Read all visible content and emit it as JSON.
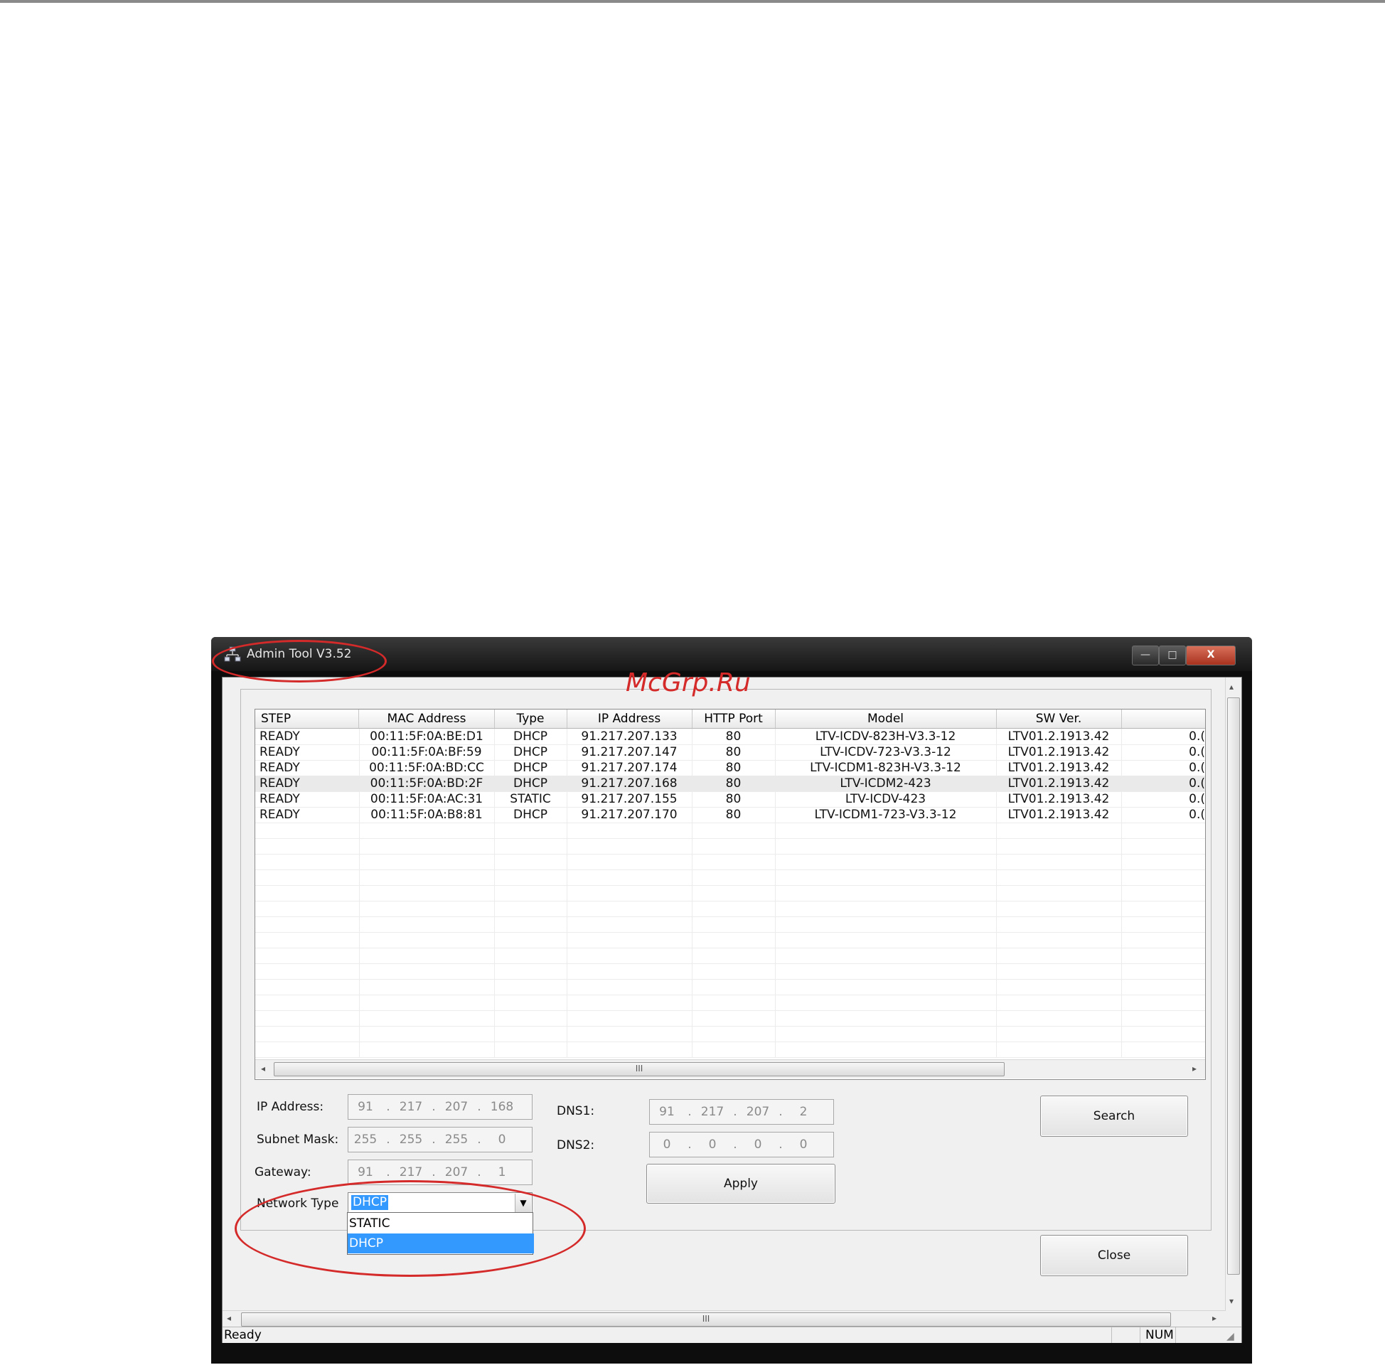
{
  "window": {
    "title": "Admin Tool V3.52",
    "controls": {
      "minimize": "—",
      "maximize": "□",
      "close": "X"
    }
  },
  "watermark": "McGrp.Ru",
  "table": {
    "columns": [
      "STEP",
      "MAC Address",
      "Type",
      "IP Address",
      "HTTP Port",
      "Model",
      "SW Ver.",
      ""
    ],
    "rows": [
      [
        "READY",
        "00:11:5F:0A:BE:D1",
        "DHCP",
        "91.217.207.133",
        "80",
        "LTV-ICDV-823H-V3.3-12",
        "LTV01.2.1913.42",
        "0.("
      ],
      [
        "READY",
        "00:11:5F:0A:BF:59",
        "DHCP",
        "91.217.207.147",
        "80",
        "LTV-ICDV-723-V3.3-12",
        "LTV01.2.1913.42",
        "0.("
      ],
      [
        "READY",
        "00:11:5F:0A:BD:CC",
        "DHCP",
        "91.217.207.174",
        "80",
        "LTV-ICDM1-823H-V3.3-12",
        "LTV01.2.1913.42",
        "0.("
      ],
      [
        "READY",
        "00:11:5F:0A:BD:2F",
        "DHCP",
        "91.217.207.168",
        "80",
        "LTV-ICDM2-423",
        "LTV01.2.1913.42",
        "0.("
      ],
      [
        "READY",
        "00:11:5F:0A:AC:31",
        "STATIC",
        "91.217.207.155",
        "80",
        "LTV-ICDV-423",
        "LTV01.2.1913.42",
        "0.("
      ],
      [
        "READY",
        "00:11:5F:0A:B8:81",
        "DHCP",
        "91.217.207.170",
        "80",
        "LTV-ICDM1-723-V3.3-12",
        "LTV01.2.1913.42",
        "0.("
      ]
    ],
    "selected_row": 3,
    "scroll_grip": "III"
  },
  "form": {
    "ip_label": "IP Address:",
    "ip": [
      "91",
      "217",
      "207",
      "168"
    ],
    "mask_label": "Subnet Mask:",
    "mask": [
      "255",
      "255",
      "255",
      "0"
    ],
    "gateway_label": "Gateway:",
    "gateway": [
      "91",
      "217",
      "207",
      "1"
    ],
    "dns1_label": "DNS1:",
    "dns1": [
      "91",
      "217",
      "207",
      "2"
    ],
    "dns2_label": "DNS2:",
    "dns2": [
      "0",
      "0",
      "0",
      "0"
    ],
    "network_type_label": "Network Type",
    "network_type_value": "DHCP",
    "network_type_options": [
      "STATIC",
      "DHCP"
    ]
  },
  "buttons": {
    "apply": "Apply",
    "search": "Search",
    "close": "Close"
  },
  "status": {
    "text": "Ready",
    "num": "NUM"
  },
  "colors": {
    "highlight": "#3399ff",
    "annotation": "#d42a2a"
  }
}
